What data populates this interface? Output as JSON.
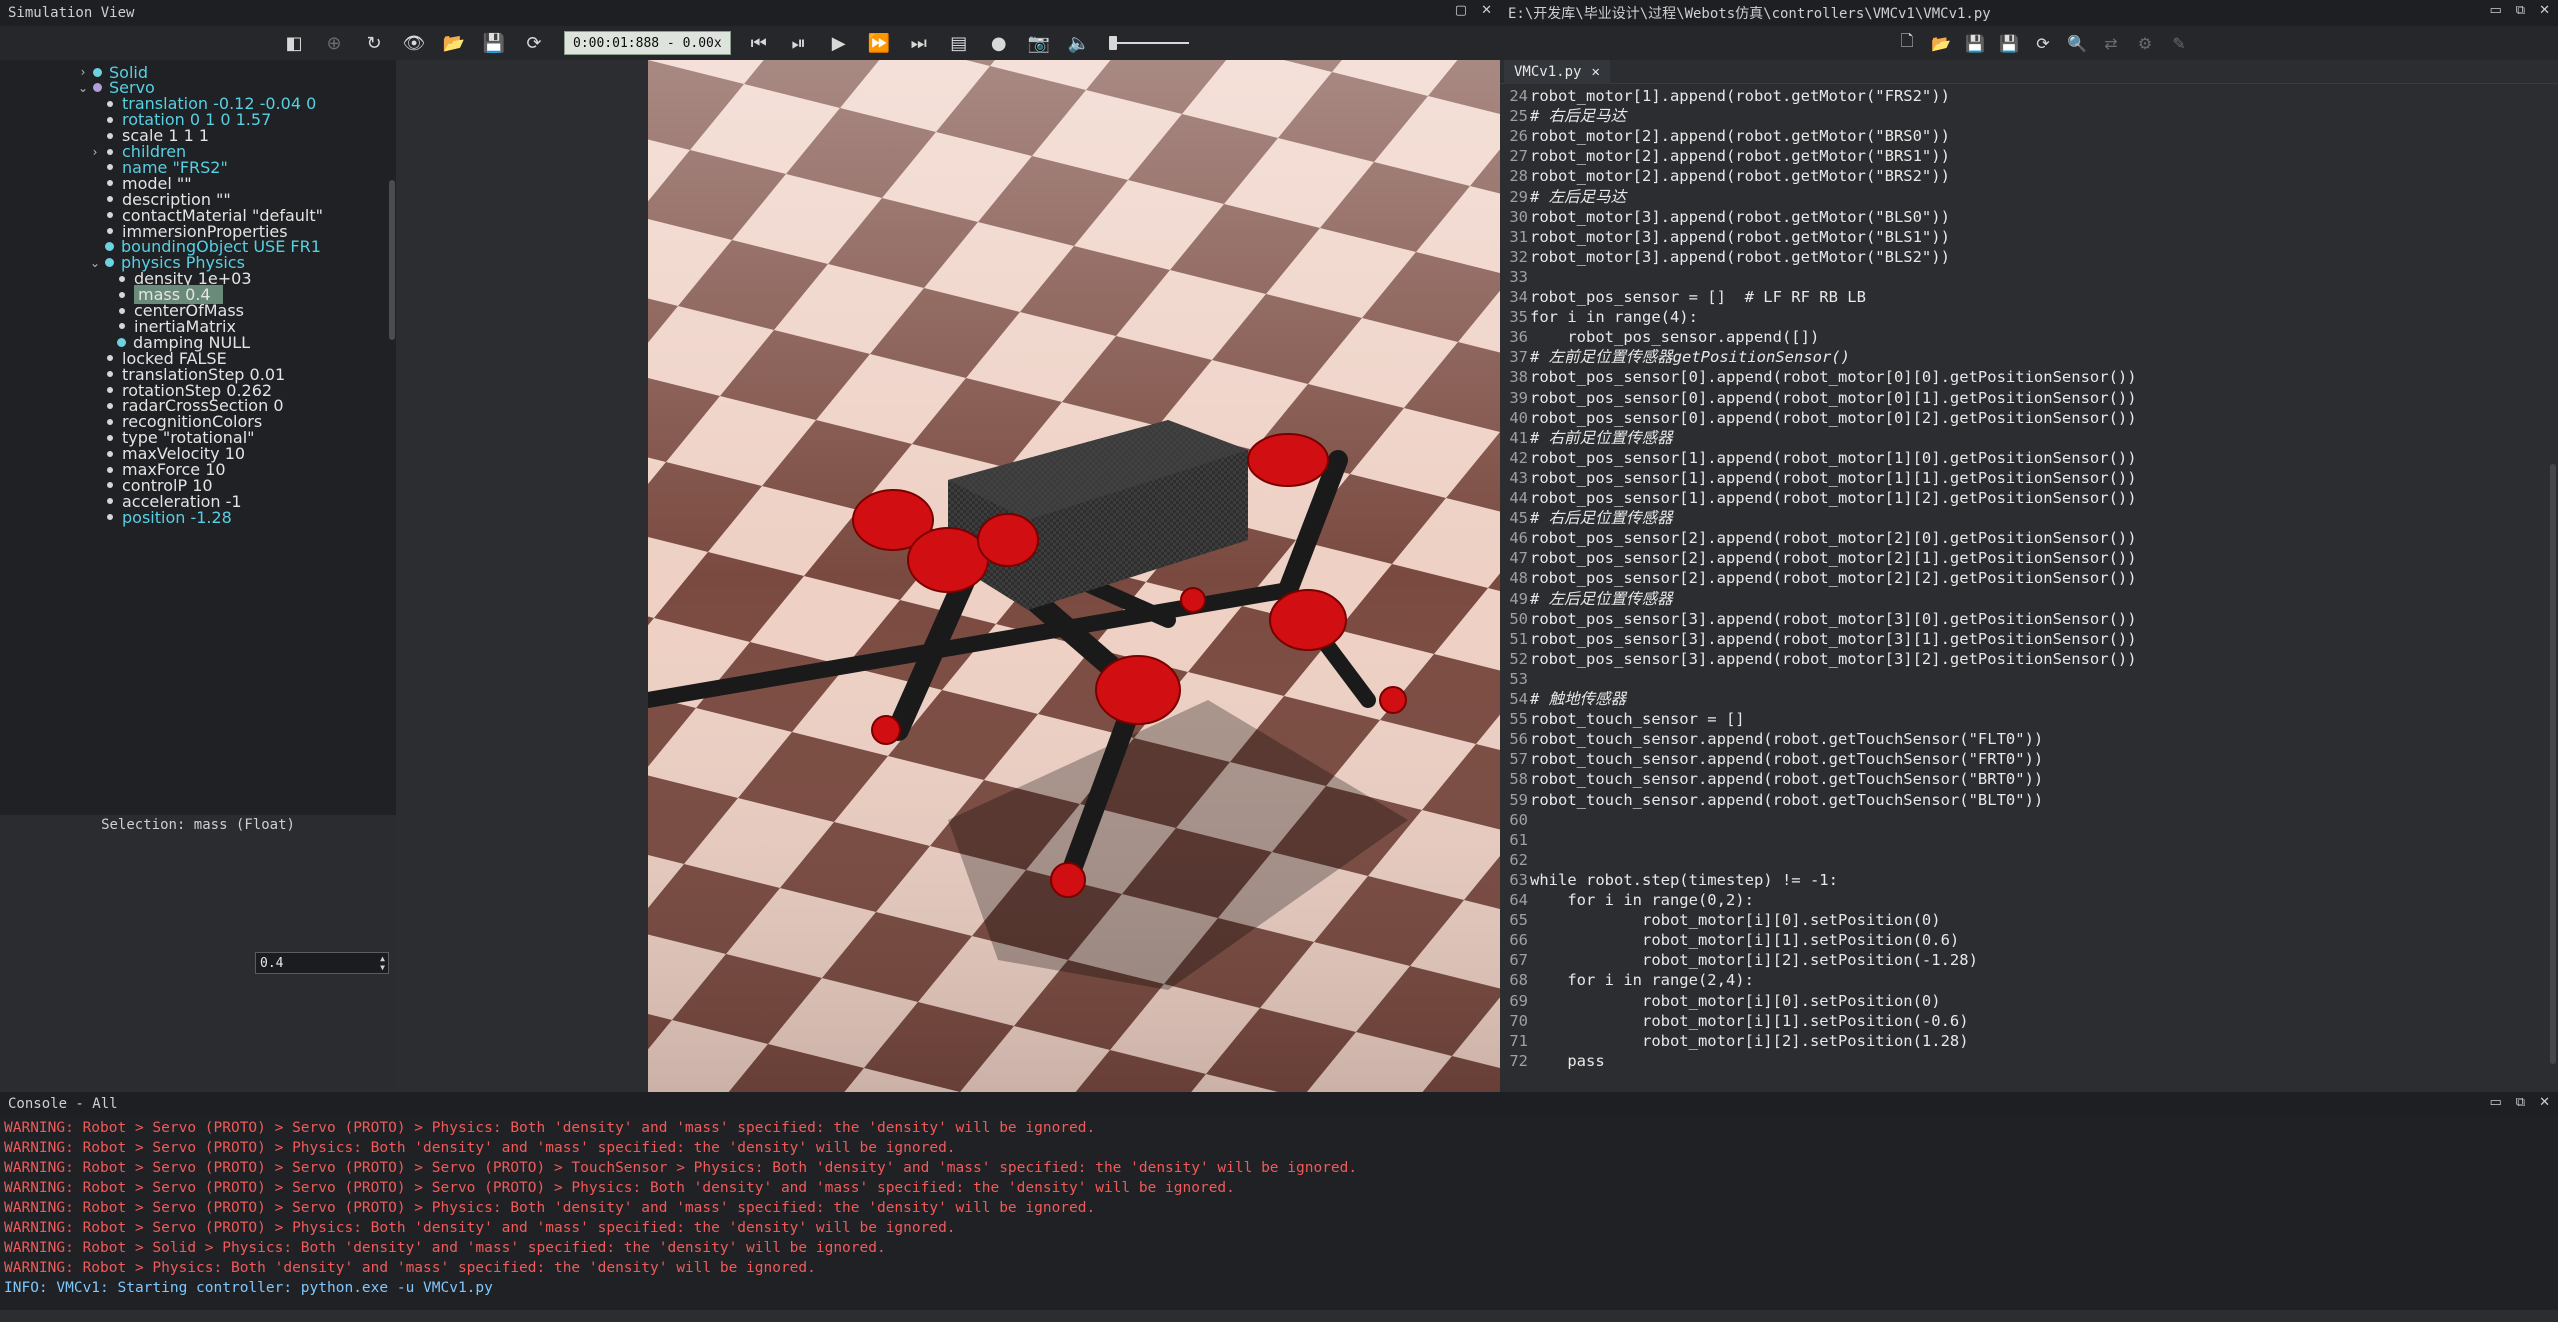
{
  "sim_window": {
    "title": "Simulation View"
  },
  "editor_window": {
    "title": "E:\\开发库\\毕业设计\\过程\\Webots仿真\\controllers\\VMCv1\\VMCv1.py"
  },
  "console_window": {
    "title": "Console - All"
  },
  "sim_toolbar": {
    "time": "0:00:01:888  - 0.00x"
  },
  "tree": {
    "items": [
      {
        "label": "Solid",
        "indent": 0,
        "arrow": "›",
        "dot": "cyan",
        "color": "cyan"
      },
      {
        "label": "Servo",
        "indent": 0,
        "arrow": "⌄",
        "dot": "purple",
        "color": "cyan"
      },
      {
        "label": "translation -0.12 -0.04 0",
        "indent": 1,
        "arrow": "",
        "dot": "small",
        "color": "cyan"
      },
      {
        "label": "rotation 0 1 0 1.57",
        "indent": 1,
        "arrow": "",
        "dot": "small",
        "color": "cyan"
      },
      {
        "label": "scale 1 1 1",
        "indent": 1,
        "arrow": "",
        "dot": "small",
        "color": "white"
      },
      {
        "label": "children",
        "indent": 1,
        "arrow": "›",
        "dot": "small",
        "color": "cyan"
      },
      {
        "label": "name \"FRS2\"",
        "indent": 1,
        "arrow": "",
        "dot": "small",
        "color": "cyan"
      },
      {
        "label": "model \"\"",
        "indent": 1,
        "arrow": "",
        "dot": "small",
        "color": "white"
      },
      {
        "label": "description \"\"",
        "indent": 1,
        "arrow": "",
        "dot": "small",
        "color": "white"
      },
      {
        "label": "contactMaterial \"default\"",
        "indent": 1,
        "arrow": "",
        "dot": "small",
        "color": "white"
      },
      {
        "label": "immersionProperties",
        "indent": 1,
        "arrow": "",
        "dot": "small",
        "color": "white"
      },
      {
        "label": "boundingObject USE FR1",
        "indent": 1,
        "arrow": "",
        "dot": "cyan",
        "color": "cyan"
      },
      {
        "label": "physics Physics",
        "indent": 1,
        "arrow": "⌄",
        "dot": "cyan",
        "color": "cyan"
      },
      {
        "label": "density 1e+03",
        "indent": 2,
        "arrow": "",
        "dot": "small",
        "color": "white"
      },
      {
        "label": "mass 0.4",
        "indent": 2,
        "arrow": "",
        "dot": "small",
        "color": "white",
        "selected": true
      },
      {
        "label": "centerOfMass",
        "indent": 2,
        "arrow": "",
        "dot": "small",
        "color": "white"
      },
      {
        "label": "inertiaMatrix",
        "indent": 2,
        "arrow": "",
        "dot": "small",
        "color": "white"
      },
      {
        "label": "damping NULL",
        "indent": 2,
        "arrow": "",
        "dot": "cyan",
        "color": "white"
      },
      {
        "label": "locked FALSE",
        "indent": 1,
        "arrow": "",
        "dot": "small",
        "color": "white"
      },
      {
        "label": "translationStep 0.01",
        "indent": 1,
        "arrow": "",
        "dot": "small",
        "color": "white"
      },
      {
        "label": "rotationStep 0.262",
        "indent": 1,
        "arrow": "",
        "dot": "small",
        "color": "white"
      },
      {
        "label": "radarCrossSection 0",
        "indent": 1,
        "arrow": "",
        "dot": "small",
        "color": "white"
      },
      {
        "label": "recognitionColors",
        "indent": 1,
        "arrow": "",
        "dot": "small",
        "color": "white"
      },
      {
        "label": "type \"rotational\"",
        "indent": 1,
        "arrow": "",
        "dot": "small",
        "color": "white"
      },
      {
        "label": "maxVelocity 10",
        "indent": 1,
        "arrow": "",
        "dot": "small",
        "color": "white"
      },
      {
        "label": "maxForce 10",
        "indent": 1,
        "arrow": "",
        "dot": "small",
        "color": "white"
      },
      {
        "label": "controlP 10",
        "indent": 1,
        "arrow": "",
        "dot": "small",
        "color": "white"
      },
      {
        "label": "acceleration -1",
        "indent": 1,
        "arrow": "",
        "dot": "small",
        "color": "white"
      },
      {
        "label": "position -1.28",
        "indent": 1,
        "arrow": "",
        "dot": "small",
        "color": "cyan"
      }
    ]
  },
  "properties": {
    "selection": "Selection: mass (Float)",
    "value": "0.4"
  },
  "editor": {
    "tab_label": "VMCv1.py",
    "lines": [
      {
        "n": "24",
        "t": "robot_motor[1].append(robot.getMotor(\"FRS2\"))"
      },
      {
        "n": "25",
        "t": "# 右后足马达"
      },
      {
        "n": "26",
        "t": "robot_motor[2].append(robot.getMotor(\"BRS0\"))"
      },
      {
        "n": "27",
        "t": "robot_motor[2].append(robot.getMotor(\"BRS1\"))"
      },
      {
        "n": "28",
        "t": "robot_motor[2].append(robot.getMotor(\"BRS2\"))"
      },
      {
        "n": "29",
        "t": "# 左后足马达"
      },
      {
        "n": "30",
        "t": "robot_motor[3].append(robot.getMotor(\"BLS0\"))"
      },
      {
        "n": "31",
        "t": "robot_motor[3].append(robot.getMotor(\"BLS1\"))"
      },
      {
        "n": "32",
        "t": "robot_motor[3].append(robot.getMotor(\"BLS2\"))"
      },
      {
        "n": "33",
        "t": ""
      },
      {
        "n": "34",
        "t": "robot_pos_sensor = []  # LF RF RB LB"
      },
      {
        "n": "35",
        "t": "for i in range(4):"
      },
      {
        "n": "36",
        "t": "    robot_pos_sensor.append([])"
      },
      {
        "n": "37",
        "t": "# 左前足位置传感器getPositionSensor()"
      },
      {
        "n": "38",
        "t": "robot_pos_sensor[0].append(robot_motor[0][0].getPositionSensor())"
      },
      {
        "n": "39",
        "t": "robot_pos_sensor[0].append(robot_motor[0][1].getPositionSensor())"
      },
      {
        "n": "40",
        "t": "robot_pos_sensor[0].append(robot_motor[0][2].getPositionSensor())"
      },
      {
        "n": "41",
        "t": "# 右前足位置传感器"
      },
      {
        "n": "42",
        "t": "robot_pos_sensor[1].append(robot_motor[1][0].getPositionSensor())"
      },
      {
        "n": "43",
        "t": "robot_pos_sensor[1].append(robot_motor[1][1].getPositionSensor())"
      },
      {
        "n": "44",
        "t": "robot_pos_sensor[1].append(robot_motor[1][2].getPositionSensor())"
      },
      {
        "n": "45",
        "t": "# 右后足位置传感器"
      },
      {
        "n": "46",
        "t": "robot_pos_sensor[2].append(robot_motor[2][0].getPositionSensor())"
      },
      {
        "n": "47",
        "t": "robot_pos_sensor[2].append(robot_motor[2][1].getPositionSensor())"
      },
      {
        "n": "48",
        "t": "robot_pos_sensor[2].append(robot_motor[2][2].getPositionSensor())"
      },
      {
        "n": "49",
        "t": "# 左后足位置传感器"
      },
      {
        "n": "50",
        "t": "robot_pos_sensor[3].append(robot_motor[3][0].getPositionSensor())"
      },
      {
        "n": "51",
        "t": "robot_pos_sensor[3].append(robot_motor[3][1].getPositionSensor())"
      },
      {
        "n": "52",
        "t": "robot_pos_sensor[3].append(robot_motor[3][2].getPositionSensor())"
      },
      {
        "n": "53",
        "t": ""
      },
      {
        "n": "54",
        "t": "# 触地传感器"
      },
      {
        "n": "55",
        "t": "robot_touch_sensor = []"
      },
      {
        "n": "56",
        "t": "robot_touch_sensor.append(robot.getTouchSensor(\"FLT0\"))"
      },
      {
        "n": "57",
        "t": "robot_touch_sensor.append(robot.getTouchSensor(\"FRT0\"))"
      },
      {
        "n": "58",
        "t": "robot_touch_sensor.append(robot.getTouchSensor(\"BRT0\"))"
      },
      {
        "n": "59",
        "t": "robot_touch_sensor.append(robot.getTouchSensor(\"BLT0\"))"
      },
      {
        "n": "60",
        "t": ""
      },
      {
        "n": "61",
        "t": ""
      },
      {
        "n": "62",
        "t": ""
      },
      {
        "n": "63",
        "t": "while robot.step(timestep) != -1:"
      },
      {
        "n": "64",
        "t": "    for i in range(0,2):"
      },
      {
        "n": "65",
        "t": "            robot_motor[i][0].setPosition(0)"
      },
      {
        "n": "66",
        "t": "            robot_motor[i][1].setPosition(0.6)"
      },
      {
        "n": "67",
        "t": "            robot_motor[i][2].setPosition(-1.28)"
      },
      {
        "n": "68",
        "t": "    for i in range(2,4):"
      },
      {
        "n": "69",
        "t": "            robot_motor[i][0].setPosition(0)"
      },
      {
        "n": "70",
        "t": "            robot_motor[i][1].setPosition(-0.6)"
      },
      {
        "n": "71",
        "t": "            robot_motor[i][2].setPosition(1.28)"
      },
      {
        "n": "72",
        "t": "    pass"
      }
    ]
  },
  "console": {
    "lines": [
      {
        "level": "warn",
        "text": "WARNING: Robot > Servo (PROTO) > Servo (PROTO) > Physics: Both 'density' and 'mass' specified: the 'density' will be ignored."
      },
      {
        "level": "warn",
        "text": "WARNING: Robot > Servo (PROTO) > Physics: Both 'density' and 'mass' specified: the 'density' will be ignored."
      },
      {
        "level": "warn",
        "text": "WARNING: Robot > Servo (PROTO) > Servo (PROTO) > Servo (PROTO) > TouchSensor > Physics: Both 'density' and 'mass' specified: the 'density' will be ignored."
      },
      {
        "level": "warn",
        "text": "WARNING: Robot > Servo (PROTO) > Servo (PROTO) > Servo (PROTO) > Physics: Both 'density' and 'mass' specified: the 'density' will be ignored."
      },
      {
        "level": "warn",
        "text": "WARNING: Robot > Servo (PROTO) > Servo (PROTO) > Physics: Both 'density' and 'mass' specified: the 'density' will be ignored."
      },
      {
        "level": "warn",
        "text": "WARNING: Robot > Servo (PROTO) > Physics: Both 'density' and 'mass' specified: the 'density' will be ignored."
      },
      {
        "level": "warn",
        "text": "WARNING: Robot > Solid > Physics: Both 'density' and 'mass' specified: the 'density' will be ignored."
      },
      {
        "level": "warn",
        "text": "WARNING: Robot > Physics: Both 'density' and 'mass' specified: the 'density' will be ignored."
      },
      {
        "level": "info",
        "text": "INFO: VMCv1: Starting controller: python.exe -u VMCv1.py"
      }
    ]
  }
}
